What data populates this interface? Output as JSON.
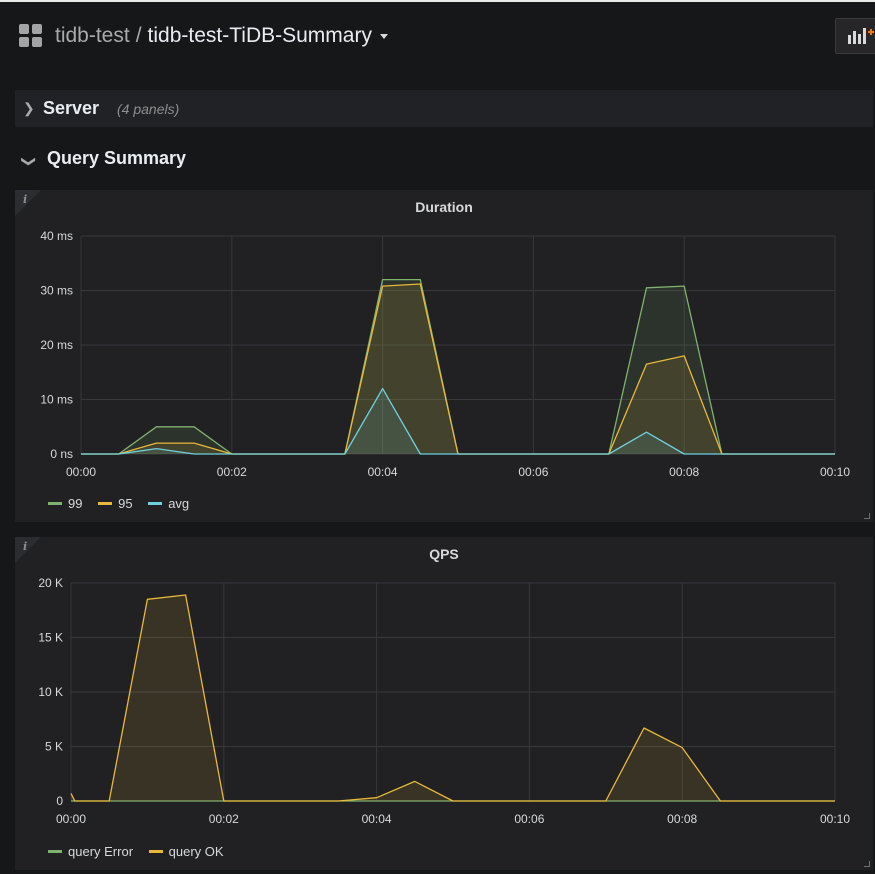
{
  "header": {
    "folder": "tidb-test",
    "separator": "/",
    "dashboard_title": "tidb-test-TiDB-Summary"
  },
  "rows": [
    {
      "title": "Server",
      "panel_count": "(4 panels)",
      "collapsed": true
    },
    {
      "title": "Query Summary",
      "collapsed": false
    }
  ],
  "colors": {
    "green": "#7eb26d",
    "yellow": "#eab839",
    "cyan": "#6ed0e0",
    "background": "#161719",
    "panel": "#212124"
  },
  "chart_data": [
    {
      "type": "area",
      "title": "Duration",
      "ylim": [
        0,
        40
      ],
      "y_ticks": [
        "0 ns",
        "10 ms",
        "20 ms",
        "30 ms",
        "40 ms"
      ],
      "x_ticks": [
        "00:00",
        "00:02",
        "00:04",
        "00:06",
        "00:08",
        "00:10"
      ],
      "xlim": [
        0,
        10
      ],
      "grid": true,
      "legend": "bottom-left",
      "x": [
        0,
        0.5,
        1,
        1.5,
        2,
        3.5,
        4,
        4.5,
        5,
        7,
        7.5,
        8,
        8.5,
        10
      ],
      "series": [
        {
          "name": "99",
          "color": "#7eb26d",
          "values": [
            0,
            0,
            5,
            5,
            0,
            0,
            32,
            32,
            0,
            0,
            30.5,
            30.8,
            0,
            0
          ]
        },
        {
          "name": "95",
          "color": "#eab839",
          "values": [
            0,
            0,
            2,
            2,
            0,
            0,
            30.8,
            31.2,
            0,
            0,
            16.5,
            18,
            0,
            0
          ]
        },
        {
          "name": "avg",
          "color": "#6ed0e0",
          "values": [
            0,
            0,
            1,
            0,
            0,
            0,
            12,
            0,
            0,
            0,
            4,
            0,
            0,
            0
          ]
        }
      ]
    },
    {
      "type": "area",
      "title": "QPS",
      "ylim": [
        0,
        20000
      ],
      "y_ticks": [
        "0",
        "5 K",
        "10 K",
        "15 K",
        "20 K"
      ],
      "x_ticks": [
        "00:00",
        "00:02",
        "00:04",
        "00:06",
        "00:08",
        "00:10"
      ],
      "xlim": [
        0,
        10
      ],
      "grid": true,
      "legend": "bottom-left",
      "series": [
        {
          "name": "query Error",
          "color": "#7eb26d",
          "x": [
            0,
            10
          ],
          "values": [
            0,
            0
          ]
        },
        {
          "name": "query OK",
          "color": "#eab839",
          "x": [
            0,
            0.05,
            0.5,
            1,
            1.5,
            2,
            3.5,
            4,
            4.5,
            5,
            7,
            7.5,
            8,
            8.5,
            10
          ],
          "values": [
            700,
            0,
            0,
            18500,
            18900,
            0,
            0,
            300,
            1800,
            0,
            0,
            6700,
            4900,
            0,
            0
          ]
        }
      ]
    }
  ]
}
